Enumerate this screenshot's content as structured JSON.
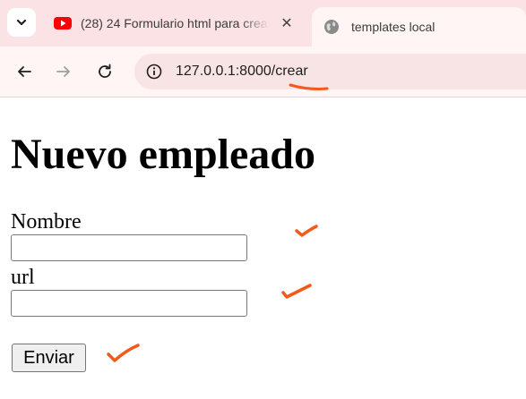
{
  "browser": {
    "tabs": [
      {
        "title": "(28) 24 Formulario html para crear",
        "favicon": "youtube-icon",
        "active": false,
        "close": "✕"
      },
      {
        "title": "templates local",
        "favicon": "globe-icon",
        "active": true
      }
    ],
    "address_bar": {
      "url": "127.0.0.1:8000/crear"
    }
  },
  "page": {
    "heading": "Nuevo empleado",
    "form": {
      "fields": [
        {
          "label": "Nombre",
          "value": ""
        },
        {
          "label": "url",
          "value": ""
        }
      ],
      "submit_label": "Enviar"
    }
  },
  "colors": {
    "tabstrip_bg": "#fbe2e4",
    "toolbar_bg": "#fff5f5",
    "omnibox_bg": "#f8e3e5",
    "annotation": "#f15a1b",
    "youtube_red": "#ff0000"
  },
  "annotations": {
    "icons": [
      "underline-mark",
      "checkmark-icon",
      "checkmark-icon",
      "checkmark-icon"
    ]
  }
}
